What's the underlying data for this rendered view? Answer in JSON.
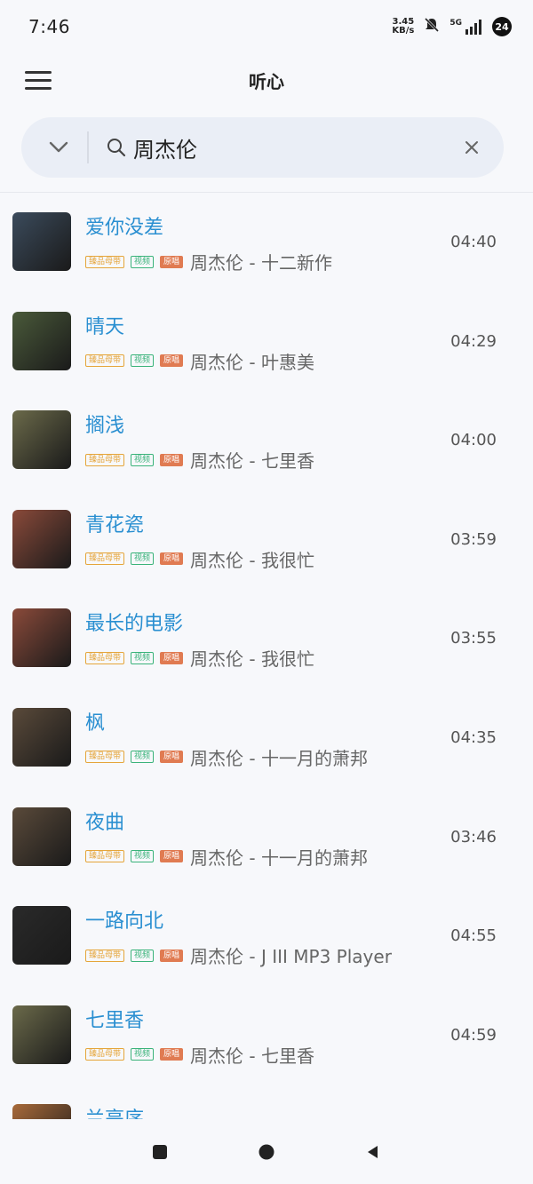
{
  "status": {
    "time": "7:46",
    "net_speed_value": "3.45",
    "net_speed_unit": "KB/s",
    "network_type": "5G",
    "battery": "24"
  },
  "header": {
    "title": "听心"
  },
  "search": {
    "query": "周杰伦"
  },
  "tags": {
    "hq": "臻品母带",
    "mv": "视频",
    "original": "原唱"
  },
  "songs": [
    {
      "title": "爱你没差",
      "artist": "周杰伦",
      "album": "十二新作",
      "subtitle": "周杰伦 - 十二新作",
      "duration": "04:40",
      "cover_color": "#3b4b5c"
    },
    {
      "title": "晴天",
      "artist": "周杰伦",
      "album": "叶惠美",
      "subtitle": "周杰伦 - 叶惠美",
      "duration": "04:29",
      "cover_color": "#4a5a3a"
    },
    {
      "title": "搁浅",
      "artist": "周杰伦",
      "album": "七里香",
      "subtitle": "周杰伦 - 七里香",
      "duration": "04:00",
      "cover_color": "#6b6a4a"
    },
    {
      "title": "青花瓷",
      "artist": "周杰伦",
      "album": "我很忙",
      "subtitle": "周杰伦 - 我很忙",
      "duration": "03:59",
      "cover_color": "#8a4a3a"
    },
    {
      "title": "最长的电影",
      "artist": "周杰伦",
      "album": "我很忙",
      "subtitle": "周杰伦 - 我很忙",
      "duration": "03:55",
      "cover_color": "#8a4a3a"
    },
    {
      "title": "枫",
      "artist": "周杰伦",
      "album": "十一月的萧邦",
      "subtitle": "周杰伦 - 十一月的萧邦",
      "duration": "04:35",
      "cover_color": "#5a4a3a"
    },
    {
      "title": "夜曲",
      "artist": "周杰伦",
      "album": "十一月的萧邦",
      "subtitle": "周杰伦 - 十一月的萧邦",
      "duration": "03:46",
      "cover_color": "#5a4a3a"
    },
    {
      "title": "一路向北",
      "artist": "周杰伦",
      "album": "J III MP3 Player",
      "subtitle": "周杰伦 - J III MP3 Player",
      "duration": "04:55",
      "cover_color": "#2a2a2a"
    },
    {
      "title": "七里香",
      "artist": "周杰伦",
      "album": "七里香",
      "subtitle": "周杰伦 - 七里香",
      "duration": "04:59",
      "cover_color": "#6b6a4a"
    },
    {
      "title": "兰亭序",
      "artist": "",
      "album": "",
      "subtitle": "",
      "duration": "",
      "cover_color": "#a86a3a"
    }
  ],
  "colors": {
    "accent": "#2a8fd1",
    "background": "#f7f8fb",
    "search_bg": "#eaeef6"
  }
}
